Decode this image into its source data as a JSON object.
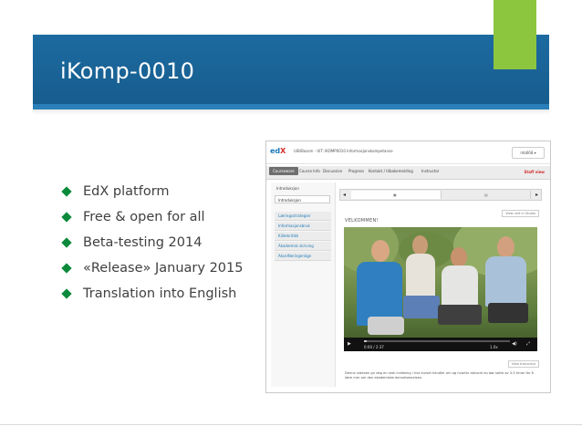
{
  "slide": {
    "title": "iKomp-0010",
    "bullets": [
      "EdX platform",
      "Free & open for all",
      "Beta-testing 2014",
      "«Release» January 2015",
      "Translation into English"
    ]
  },
  "screenshot": {
    "logo_e": "ed",
    "logo_x": "X",
    "course_title": "UiB/Bassm - UIT: IKOMP0010 Informasjonskompetanse",
    "user_button": "mb668 ▾",
    "nav": {
      "items": [
        "Courseware",
        "Course Info",
        "Discussion",
        "Progress",
        "Kontakt / tilbakemelding",
        "Instructor"
      ],
      "staff_label": "Staff view"
    },
    "sidebar": {
      "section_title": "Introduksjon",
      "active_item": "Introduksjon",
      "items": [
        "Læringsstrategier",
        "Informasjonsbruk",
        "Kildekritikk",
        "Akademisk skriving",
        "Akselfæringenlige"
      ]
    },
    "sequence": {
      "prev": "◂",
      "next": "▸",
      "cell_labels": [
        "▣",
        "▤"
      ]
    },
    "subscribe_button": "View unit in Studio",
    "unit_heading": "VELKOMMEN!",
    "video": {
      "time": "0:00 / 2:37",
      "speed": "1.0x",
      "play_icon": "▶",
      "fullscreen_icon": "⤢",
      "volume_icon": "◀)",
      "progress": 0.02
    },
    "download_button": "View transcript",
    "caption": "Denne videoen gir deg en rask innføring i hva kurset handler om og hvorfor akkurat du bør sette av 3-5 timer for å lære mer om den akademiske dannelsesreisen."
  },
  "colors": {
    "title_band": "#1c6aa0",
    "accent_green": "#8cc63e",
    "bullet_green": "#0a8a3a"
  }
}
